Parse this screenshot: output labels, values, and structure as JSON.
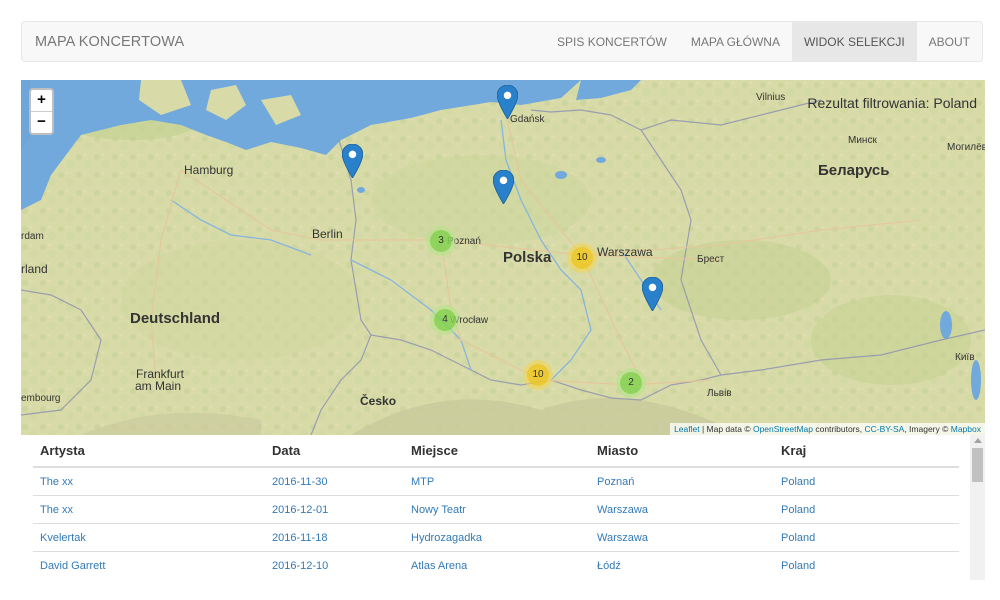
{
  "navbar": {
    "brand": "MAPA KONCERTOWA",
    "items": [
      {
        "label": "SPIS KONCERTÓW",
        "active": false
      },
      {
        "label": "MAPA GŁÓWNA",
        "active": false
      },
      {
        "label": "WIDOK SELEKCJI",
        "active": true
      },
      {
        "label": "ABOUT",
        "active": false
      }
    ]
  },
  "map": {
    "zoom_in": "+",
    "zoom_out": "−",
    "filter_result": "Rezultat filtrowania: Poland",
    "labels": {
      "vilnius": "Vilnius",
      "gdansk": "Gdańsk",
      "hamburg": "Hamburg",
      "minsk": "Минск",
      "mogilev": "Могилёв",
      "belarus": "Беларусь",
      "amsterdam": "rdam",
      "berlin": "Berlin",
      "poznan": "Poznań",
      "warszawa": "Warszawa",
      "polska": "Polska",
      "land": "rland",
      "brest": "Брест",
      "deutschland": "Deutschland",
      "wroclaw": "Wrocław",
      "frankfurt1": "Frankfurt",
      "frankfurt2": "am Main",
      "kyiv": "Київ",
      "lviv": "Львів",
      "cesko": "Česko",
      "luxembourg": "embourg"
    },
    "clusters": [
      {
        "count": "3",
        "color": "green"
      },
      {
        "count": "10",
        "color": "yellow"
      },
      {
        "count": "4",
        "color": "green"
      },
      {
        "count": "10",
        "color": "yellow"
      },
      {
        "count": "2",
        "color": "green"
      }
    ],
    "attribution": {
      "leaflet": "Leaflet",
      "sep1": " | Map data © ",
      "osm": "OpenStreetMap",
      "sep2": " contributors, ",
      "license": "CC-BY-SA",
      "sep3": ", Imagery © ",
      "mapbox": "Mapbox"
    }
  },
  "table": {
    "headers": [
      "Artysta",
      "Data",
      "Miejsce",
      "Miasto",
      "Kraj"
    ],
    "rows": [
      [
        "The xx",
        "2016-11-30",
        "MTP",
        "Poznań",
        "Poland"
      ],
      [
        "The xx",
        "2016-12-01",
        "Nowy Teatr",
        "Warszawa",
        "Poland"
      ],
      [
        "Kvelertak",
        "2016-11-18",
        "Hydrozagadka",
        "Warszawa",
        "Poland"
      ],
      [
        "David Garrett",
        "2016-12-10",
        "Atlas Arena",
        "Łódź",
        "Poland"
      ]
    ]
  },
  "colors": {
    "link": "#337ab7",
    "sea": "#6ea7dc",
    "land": "#d9dcaa",
    "marker": "#2a81cb"
  }
}
